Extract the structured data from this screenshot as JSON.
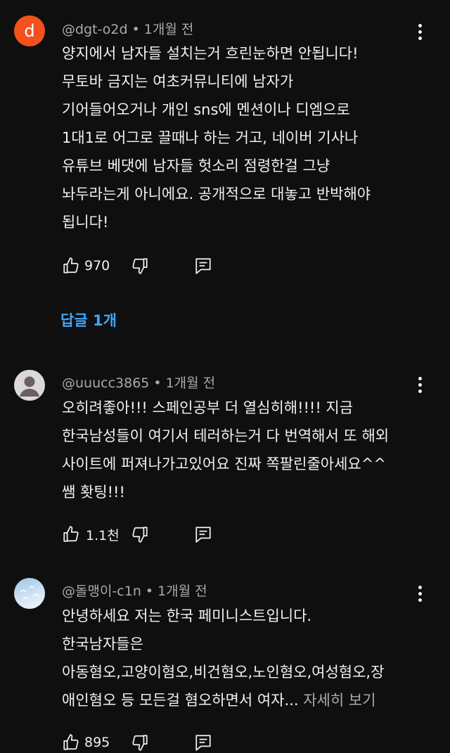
{
  "comments": [
    {
      "avatar_letter": "d",
      "author": "@dgt-o2d",
      "separator": "•",
      "time": "1개월 전",
      "lines": [
        "양지에서 남자들 설치는거 흐린눈하면 안됩니다!",
        "무토바 금지는 여초커뮤니티에 남자가",
        "기어들어오거나 개인 sns에 멘션이나 디엠으로",
        "1대1로 어그로 끌때나 하는 거고, 네이버 기사나",
        "유튜브 베댓에 남자들 헛소리 점령한걸 그냥",
        "놔두라는게 아니에요. 공개적으로 대놓고 반박해야",
        "됩니다!"
      ],
      "likes": "970",
      "replies_label": "답글 1개"
    },
    {
      "author": "@uuucc3865",
      "separator": "•",
      "time": "1개월 전",
      "lines": [
        "오히려좋아!!! 스페인공부 더 열심히해!!!! 지금",
        "한국남성들이 여기서 테러하는거 다 번역해서 또 해외",
        "사이트에 퍼져나가고있어요 진짜 쪽팔린줄아세요^^",
        "쌤 홧팅!!!"
      ],
      "likes": "1.1천"
    },
    {
      "author": "@돌맹이-c1n",
      "separator": "•",
      "time": "1개월 전",
      "lines": [
        "안녕하세요 저는 한국 페미니스트입니다.",
        "한국남자들은",
        "아동혐오,고양이혐오,비건혐오,노인혐오,여성혐오,장",
        "애인혐오 등 모든걸 혐오하면서 여자..."
      ],
      "read_more": "자세히 보기",
      "likes": "895"
    }
  ],
  "icons": {
    "like": "thumb-up-icon",
    "dislike": "thumb-down-icon",
    "reply": "comment-reply-icon",
    "more": "more-vert-icon"
  },
  "colors": {
    "background": "#0f0f0f",
    "text": "#f1f1f1",
    "secondary": "#aaaaaa",
    "link": "#3ea6ff",
    "avatar_letter_bg": "#f4511e"
  }
}
